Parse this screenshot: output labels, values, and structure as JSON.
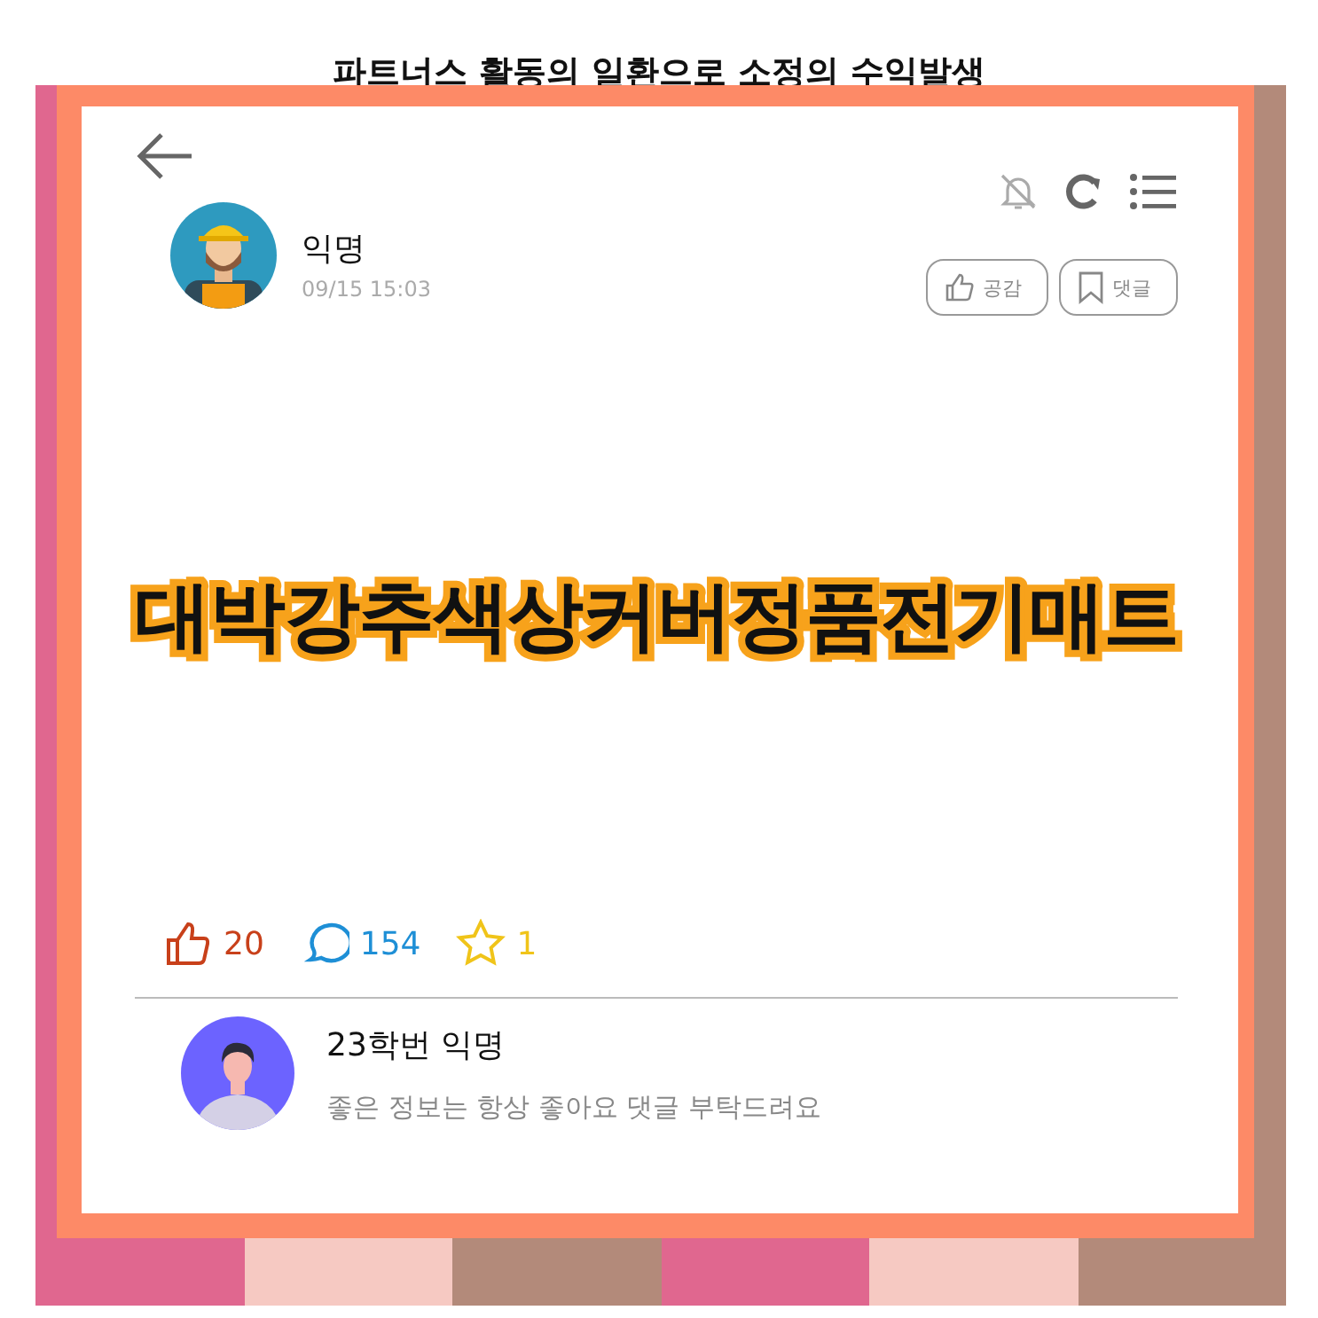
{
  "caption": "파트너스 활동의 일환으로 소정의 수익발생",
  "post": {
    "author": "익명",
    "time": "09/15 15:03",
    "actions": [
      {
        "kind": "like",
        "label": "공감"
      },
      {
        "kind": "bookmark",
        "label": "댓글"
      }
    ],
    "title": "대박강추색상커버정품전기매트",
    "stats": [
      {
        "kind": "like",
        "count": "20",
        "color": "#c8401a"
      },
      {
        "kind": "comment",
        "count": "154",
        "color": "#1e8fd6"
      },
      {
        "kind": "star",
        "count": "1",
        "color": "#f0c419"
      }
    ]
  },
  "comment": {
    "author": "23학번 익명",
    "text": "좋은 정보는 항상 좋아요 댓글 부탁드려요"
  }
}
